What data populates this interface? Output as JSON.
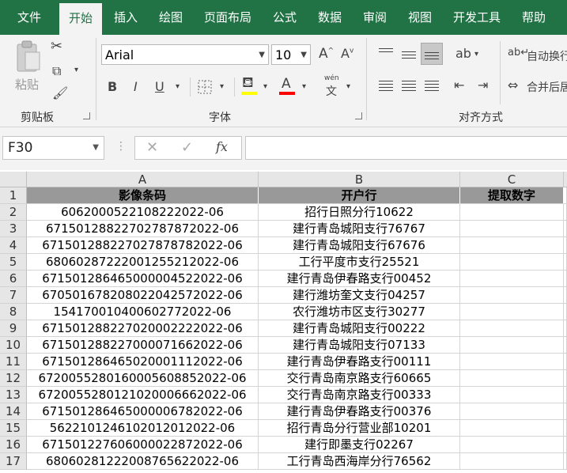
{
  "menu": {
    "tabs": [
      "文件",
      "开始",
      "插入",
      "绘图",
      "页面布局",
      "公式",
      "数据",
      "审阅",
      "视图",
      "开发工具",
      "帮助"
    ]
  },
  "ribbon": {
    "clipboard": {
      "paste_label": "粘贴",
      "group_label": "剪贴板"
    },
    "font": {
      "name": "Arial",
      "size": "10",
      "bold": "B",
      "italic": "I",
      "underline": "U",
      "font_color_letter": "A",
      "phonetic_top": "wén",
      "phonetic_bottom": "文",
      "group_label": "字体",
      "fill_color": "#ffff00",
      "font_color": "#ff0000"
    },
    "alignment": {
      "wrap_text": "自动换行",
      "merge_center": "合并后居",
      "group_label": "对齐方式"
    }
  },
  "formula_bar": {
    "name_box": "F30",
    "fx": "fx",
    "formula": ""
  },
  "sheet": {
    "columns": [
      "A",
      "B",
      "C"
    ],
    "rows": [
      "1",
      "2",
      "3",
      "4",
      "5",
      "6",
      "7",
      "8",
      "9",
      "10",
      "11",
      "12",
      "13",
      "14",
      "15",
      "16",
      "17"
    ],
    "header": [
      "影像条码",
      "开户行",
      "提取数字"
    ],
    "data": [
      [
        "606200052210822​2022-06",
        "招行日照分行10622",
        ""
      ],
      [
        "671501288227027878​72022-06",
        "建行青岛城阳支行76767",
        ""
      ],
      [
        "671501288227027878​782022-06",
        "建行青岛城阳支行67676",
        ""
      ],
      [
        "68060287222001255​212022-06",
        "工行平度市支行25521",
        ""
      ],
      [
        "671501286465000004​522022-06",
        "建行青岛伊春路支行00452",
        ""
      ],
      [
        "670501678208022042​572022-06",
        "建行潍坊奎文支行04257",
        ""
      ],
      [
        "15417001040060277​2022-06",
        "农行潍坊市区支行30277",
        ""
      ],
      [
        "671501288227020002​222022-06",
        "建行青岛城阳支行00222",
        ""
      ],
      [
        "671501288227000071​662022-06",
        "建行青岛城阳支行07133",
        ""
      ],
      [
        "671501286465020001​112022-06",
        "建行青岛伊春路支行00111",
        ""
      ],
      [
        "672005528016000560​8852022-06",
        "交行青岛南京路支行60665",
        ""
      ],
      [
        "672005528012102000​6662022-06",
        "交行青岛南京路支行00333",
        ""
      ],
      [
        "671501286465000006​782022-06",
        "建行青岛伊春路支行00376",
        ""
      ],
      [
        "56221012461020120​12022-06",
        "招行青岛分行营业部10201",
        ""
      ],
      [
        "671501227606000022​872022-06",
        "建行即墨支行02267",
        ""
      ],
      [
        "68060281222008765​622022-06",
        "工行青岛西海岸分行76562",
        ""
      ]
    ]
  }
}
